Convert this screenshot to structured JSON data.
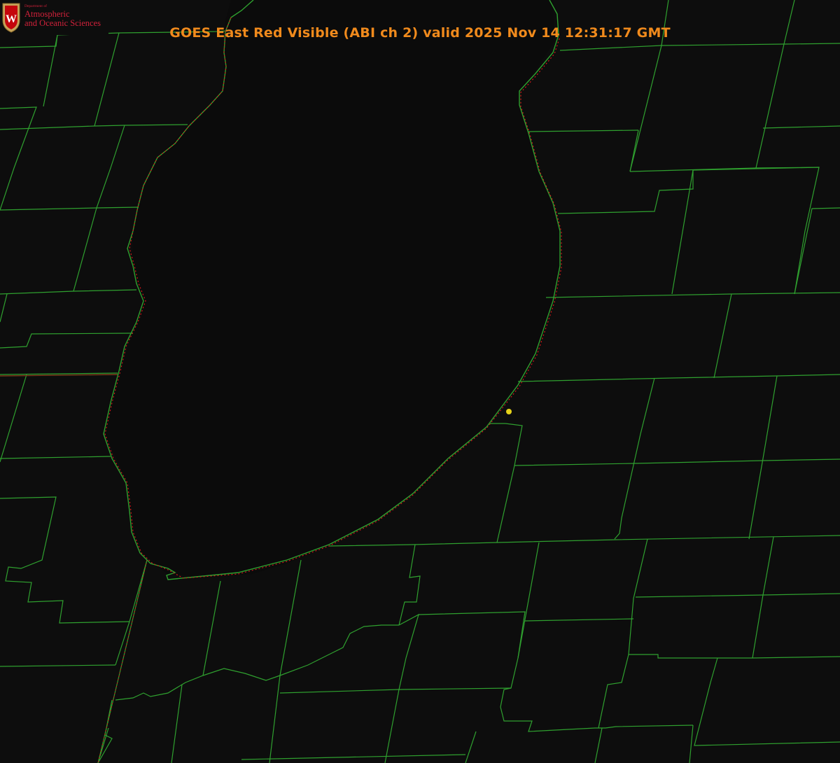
{
  "title": "GOES East Red Visible (ABI ch 2) valid 2025 Nov 14 12:31:17 GMT",
  "logo": {
    "dept": "Department of",
    "line1": "Atmospheric",
    "line2": "and Oceanic Sciences",
    "shield_letter": "W"
  },
  "colors": {
    "background": "#0d0d0d",
    "county_lines": "#2fa02f",
    "coast_dotted": "#d11a1a",
    "title": "#f08a1c",
    "marker": "#e5d21a",
    "logo_red": "#d1213a"
  },
  "map": {
    "features": [
      "lake-shoreline",
      "county-borders",
      "state-border",
      "station-marker"
    ]
  }
}
